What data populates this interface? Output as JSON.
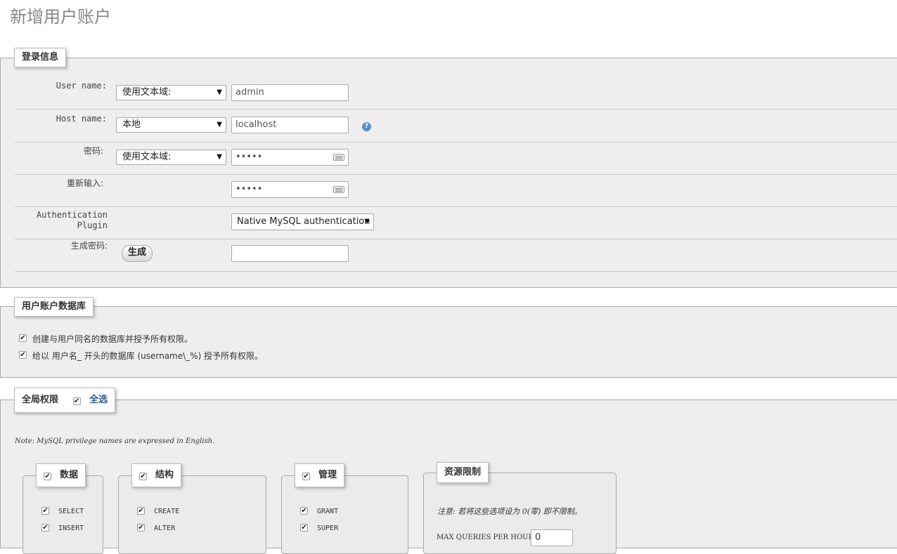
{
  "page_title": "新增用户账户",
  "login_section": {
    "legend": "登录信息",
    "user_name": {
      "label": "User name:",
      "select": "使用文本域:",
      "value": "admin"
    },
    "host_name": {
      "label": "Host name:",
      "select": "本地",
      "value": "localhost",
      "help_icon": "help-icon"
    },
    "password": {
      "label": "密码:",
      "select": "使用文本域:",
      "value": "•••••"
    },
    "retype": {
      "label": "重新输入:",
      "value": "•••••"
    },
    "auth_plugin": {
      "label_line1": "Authentication",
      "label_line2": "Plugin",
      "select": "Native MySQL authentication"
    },
    "generate": {
      "label": "生成密码:",
      "button": "生成",
      "value": ""
    }
  },
  "db_section": {
    "legend": "用户账户数据库",
    "option1": "创建与用户同名的数据库并授予所有权限。",
    "option2": "给以 用户名_ 开头的数据库 (username\\_%) 授予所有权限。"
  },
  "global_section": {
    "legend": "全局权限",
    "select_all": "全选",
    "note": "Note: MySQL privilege names are expressed in English.",
    "groups": {
      "data": {
        "title": "数据",
        "items": [
          "SELECT",
          "INSERT"
        ]
      },
      "structure": {
        "title": "结构",
        "items": [
          "CREATE",
          "ALTER"
        ]
      },
      "admin": {
        "title": "管理",
        "items": [
          "GRANT",
          "SUPER"
        ]
      },
      "resources": {
        "title": "资源限制",
        "note": "注意: 若将这些选项设为 0(零) 即不限制。",
        "max_queries_label": "MAX QUERIES PER HOUR",
        "max_queries_value": "0"
      }
    }
  },
  "colors": {
    "panel_bg": "#eeeeee",
    "link": "#2a5a8a"
  }
}
